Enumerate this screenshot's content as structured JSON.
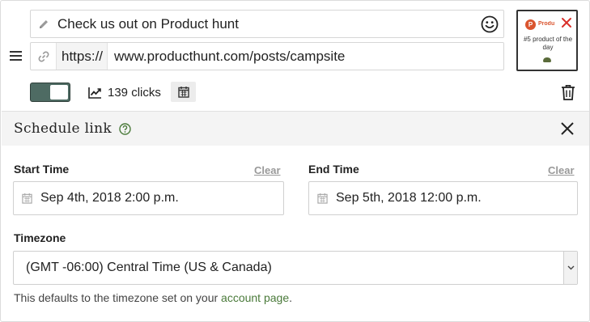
{
  "link": {
    "title": "Check us out on Product hunt",
    "protocol": "https://",
    "url": "www.producthunt.com/posts/campsite",
    "enabled": true,
    "clicks_label": "139 clicks"
  },
  "preview": {
    "logo_letter": "P",
    "brand_name": "Product Hunt",
    "badge_text": "#5 product of the day"
  },
  "schedule": {
    "title": "Schedule link",
    "start_label": "Start Time",
    "end_label": "End Time",
    "clear_label": "Clear",
    "start_value": "Sep 4th, 2018 2:00 p.m.",
    "end_value": "Sep 5th, 2018 12:00 p.m.",
    "timezone_label": "Timezone",
    "timezone_value": "(GMT -06:00) Central Time (US & Canada)",
    "note_prefix": "This defaults to the timezone set on your ",
    "note_link": "account page",
    "note_suffix": "."
  },
  "colors": {
    "accent": "#4e6b63",
    "link": "#4a7a3a",
    "producthunt": "#da552f",
    "close_red": "#d9302a"
  },
  "icons": [
    "drag-handle-icon",
    "pencil-icon",
    "smiley-icon",
    "link-icon",
    "chart-icon",
    "calendar-icon",
    "trash-icon",
    "help-icon",
    "close-icon",
    "chevron-down-icon"
  ]
}
